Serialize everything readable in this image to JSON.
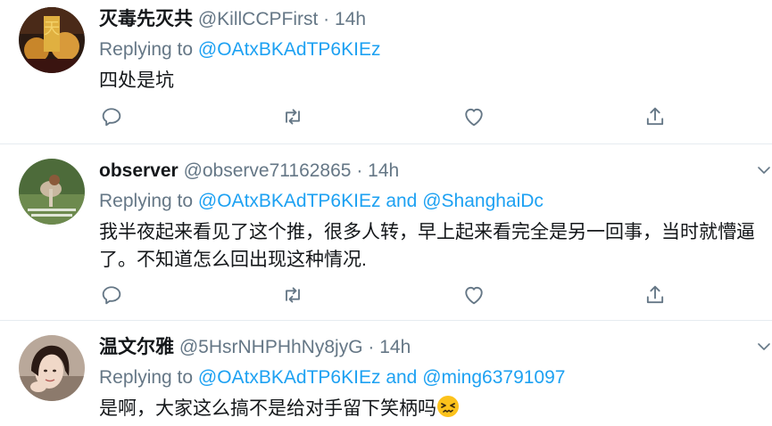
{
  "colors": {
    "link": "#1da1f2",
    "secondary_text": "#657786",
    "primary_text": "#14171a",
    "divider": "#e6ecf0"
  },
  "icons": {
    "reply": "reply-icon",
    "retweet": "retweet-icon",
    "like": "heart-icon",
    "share": "share-icon",
    "more": "chevron-down-icon"
  },
  "tweets": [
    {
      "name": "灭毒先灭共",
      "handle": "@KillCCPFirst",
      "dot": "·",
      "time": "14h",
      "replying_prefix": "Replying to",
      "mentions": [
        "@OAtxBKAdTP6KIEz"
      ],
      "conjunction": "",
      "text": "四处是坑",
      "emoji": ""
    },
    {
      "name": "observer",
      "handle": "@observe71162865",
      "dot": "·",
      "time": "14h",
      "replying_prefix": "Replying to",
      "mentions": [
        "@OAtxBKAdTP6KIEz",
        "@ShanghaiDc"
      ],
      "conjunction": "and",
      "text": "我半夜起来看见了这个推，很多人转，早上起来看完全是另一回事，当时就懵逼了。不知道怎么回出现这种情况.",
      "emoji": ""
    },
    {
      "name": "温文尔雅",
      "handle": "@5HsrNHPHhNy8jyG",
      "dot": "·",
      "time": "14h",
      "replying_prefix": "Replying to",
      "mentions": [
        "@OAtxBKAdTP6KIEz",
        "@ming63791097"
      ],
      "conjunction": "and",
      "text": "是啊，大家这么搞不是给对手留下笑柄吗",
      "emoji": "persevering-face-emoji"
    }
  ]
}
